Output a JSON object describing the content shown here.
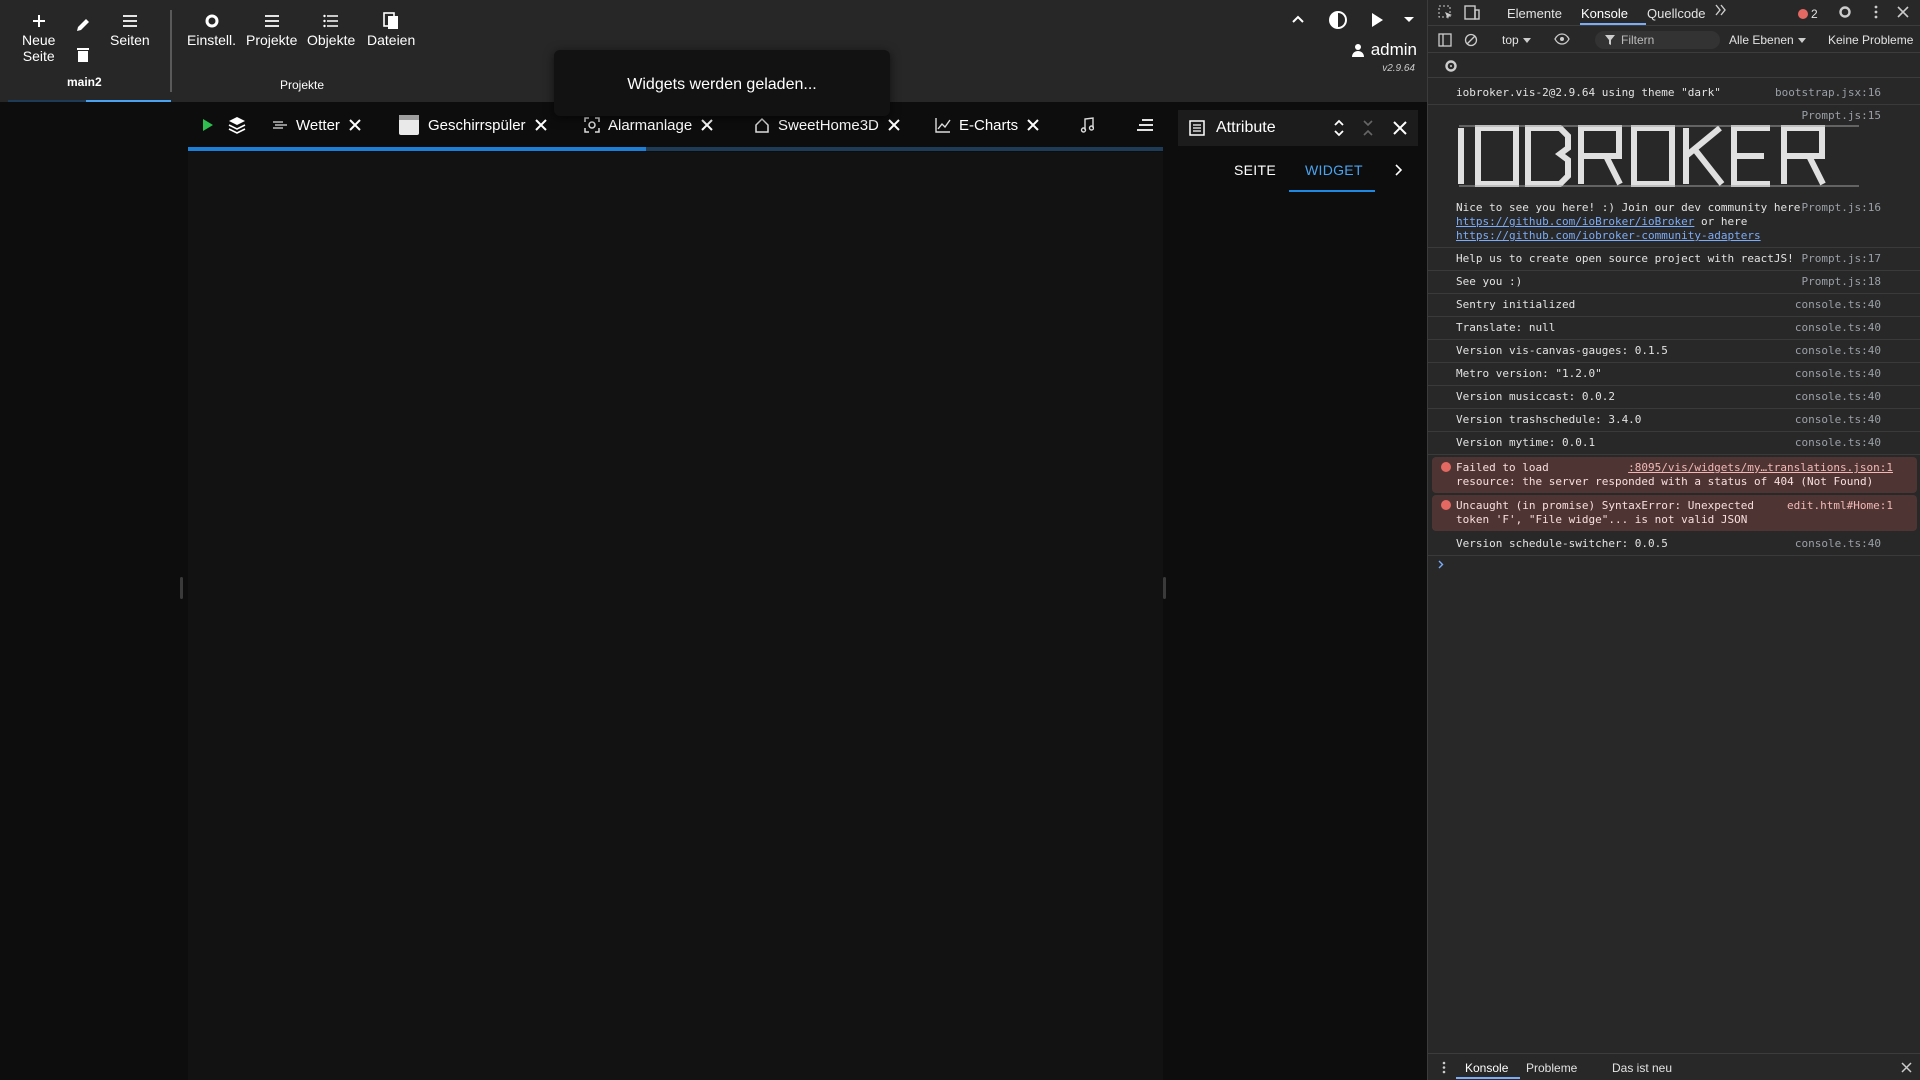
{
  "toolbar": {
    "new_page_label_1": "Neue",
    "new_page_label_2": "Seite",
    "pages_label": "Seiten",
    "page_name": "main2",
    "settings_label": "Einstell.",
    "projects_label": "Projekte",
    "objects_label": "Objekte",
    "files_label": "Dateien",
    "group_label": "Projekte"
  },
  "user": {
    "name": "admin",
    "version": "v2.9.64"
  },
  "toast": {
    "message": "Widgets werden geladen..."
  },
  "tabs": [
    {
      "label": "Wetter",
      "icon": "weather-icon"
    },
    {
      "label": "Geschirrspüler",
      "icon": "dishwasher-icon"
    },
    {
      "label": "Alarmanlage",
      "icon": "alarm-icon"
    },
    {
      "label": "SweetHome3D",
      "icon": "home-icon"
    },
    {
      "label": "E-Charts",
      "icon": "chart-icon"
    }
  ],
  "loading_progress": 0.47,
  "attributes": {
    "title": "Attribute",
    "tab_page": "SEITE",
    "tab_widget": "WIDGET",
    "active_tab": "WIDGET"
  },
  "devtools": {
    "tabs": [
      "Elemente",
      "Konsole",
      "Quellcode"
    ],
    "active_tab": "Konsole",
    "error_count": "2",
    "context": "top",
    "filter_placeholder": "Filtern",
    "levels": "Alle Ebenen",
    "issues": "Keine Probleme",
    "bottom_tabs": [
      "Konsole",
      "Probleme",
      "Das ist neu"
    ],
    "banner_text": "IOBROKER",
    "console": [
      {
        "text": "iobroker.vis-2@2.9.64 using theme \"dark\"",
        "src": "bootstrap.jsx:16",
        "type": "log"
      },
      {
        "text": "",
        "src": "Prompt.js:15",
        "type": "banner"
      },
      {
        "text": "Nice to see you here! :) Join our dev community here",
        "link1": "https://github.com/ioBroker/ioBroker",
        "mid": " or here",
        "link2": "https://github.com/iobroker-community-adapters",
        "src": "Prompt.js:16",
        "type": "links"
      },
      {
        "text": "Help us to create open source project with reactJS!",
        "src": "Prompt.js:17",
        "type": "log"
      },
      {
        "text": "See you :)",
        "src": "Prompt.js:18",
        "type": "log"
      },
      {
        "text": "Sentry initialized",
        "src": "console.ts:40",
        "type": "log"
      },
      {
        "text": "Translate: null",
        "src": "console.ts:40",
        "type": "log"
      },
      {
        "text": "Version vis-canvas-gauges: 0.1.5",
        "src": "console.ts:40",
        "type": "log"
      },
      {
        "text": "Metro version: \"1.2.0\"",
        "src": "console.ts:40",
        "type": "log"
      },
      {
        "text": "Version musiccast: 0.0.2",
        "src": "console.ts:40",
        "type": "log"
      },
      {
        "text": "Version trashschedule: 3.4.0",
        "src": "console.ts:40",
        "type": "log"
      },
      {
        "text": "Version mytime: 0.0.1",
        "src": "console.ts:40",
        "type": "log"
      },
      {
        "text": "Failed to load",
        "text2": "resource: the server responded with a status of 404 (Not Found)",
        "src": ":8095/vis/widgets/my…translations.json:1",
        "type": "error"
      },
      {
        "text": "Uncaught (in promise) SyntaxError: Unexpected",
        "text2": "token 'F', \"File widge\"... is not valid JSON",
        "src": "edit.html#Home:1",
        "type": "error"
      },
      {
        "text": "Version schedule-switcher: 0.0.5",
        "src": "console.ts:40",
        "type": "log"
      }
    ]
  },
  "colors": {
    "accent": "#1e88e5",
    "progress": "#1e7fd6",
    "toolbar_bg": "#272727",
    "error_bg": "#4e3534"
  }
}
